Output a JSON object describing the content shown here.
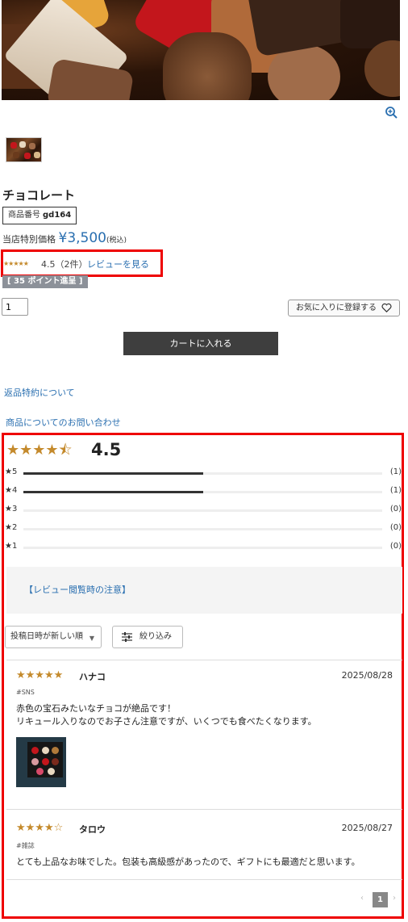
{
  "product": {
    "title": "チョコレート",
    "code_label": "商品番号",
    "code": "gd164",
    "price_label": "当店特別価格",
    "price": "¥3,500",
    "tax_label": "(税込)",
    "rating_stars": "★★★★★",
    "rating_text": "4.5（2件）",
    "review_link": "レビューを見る",
    "points": "[ 35 ポイント進呈 ]",
    "quantity": "1",
    "favorite_label": "お気に入りに登録する",
    "cart_label": "カートに入れる",
    "return_link": "返品特約について",
    "inquiry_link": "商品についてのお問い合わせ"
  },
  "review_summary": {
    "stars": "★★★★⯪",
    "average": "4.5",
    "distribution": [
      {
        "label": "★5",
        "count_text": "(1)",
        "share": 0.5
      },
      {
        "label": "★4",
        "count_text": "(1)",
        "share": 0.5
      },
      {
        "label": "★3",
        "count_text": "(0)",
        "share": 0
      },
      {
        "label": "★2",
        "count_text": "(0)",
        "share": 0
      },
      {
        "label": "★1",
        "count_text": "(0)",
        "share": 0
      }
    ],
    "notice": "【レビュー閲覧時の注意】",
    "sort_label": "投稿日時が新しい順",
    "filter_label": "絞り込み"
  },
  "reviews": [
    {
      "stars": "★★★★★",
      "name": "ハナコ",
      "date": "2025/08/28",
      "tag": "#SNS",
      "body_1": "赤色の宝石みたいなチョコが絶品です！",
      "body_2": "リキュール入りなのでお子さん注意ですが、いくつでも食べたくなります。",
      "has_photo": true
    },
    {
      "stars": "★★★★☆",
      "name": "タロウ",
      "date": "2025/08/27",
      "tag": "#雑誌",
      "body_1": "とても上品なお味でした。包装も高級感があったので、ギフトにも最適だと思います。",
      "body_2": "",
      "has_photo": false
    }
  ],
  "pagination": {
    "prev": "‹",
    "current": "1",
    "next": "›"
  },
  "icons": {
    "zoom": "zoom-in-icon",
    "heart": "heart-icon",
    "filter": "sliders-icon",
    "caret": "caret-down-icon"
  },
  "colors": {
    "star": "#c48a2c",
    "link": "#2a6fb0",
    "highlight_border": "#e00",
    "cart_bg": "#3e3e3e"
  }
}
